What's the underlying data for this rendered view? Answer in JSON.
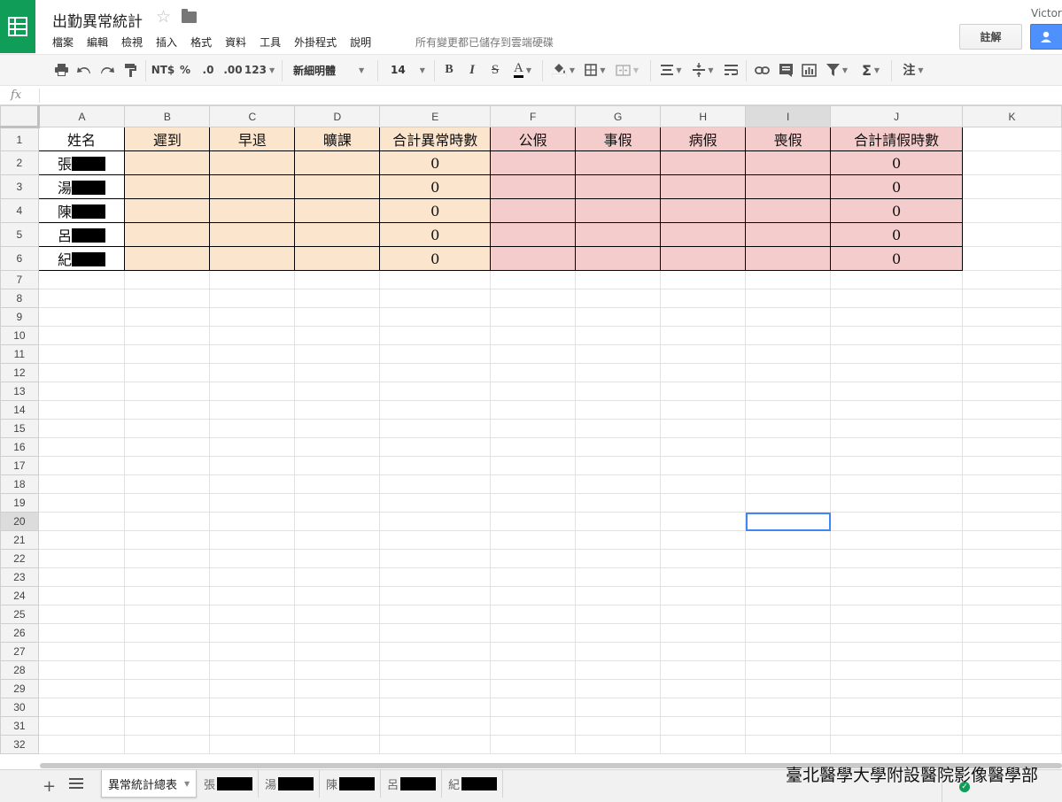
{
  "app": {
    "title": "出勤異常統計",
    "save_status": "所有變更都已儲存到雲端硬碟",
    "user_name": "Victor",
    "comments_label": "註解"
  },
  "menu": [
    "檔案",
    "編輯",
    "檢視",
    "插入",
    "格式",
    "資料",
    "工具",
    "外掛程式",
    "說明"
  ],
  "toolbar": {
    "currency": "NT$",
    "percent": "%",
    "decrease_decimals": ".0",
    "increase_decimals": ".00",
    "more_formats": "123",
    "font": "新細明體",
    "font_size": "14",
    "bold": "B",
    "italic": "I",
    "strike": "S",
    "text_color": "A",
    "sigma": "Σ",
    "notes": "注"
  },
  "formula_bar": {
    "fx": "fx",
    "value": ""
  },
  "columns": [
    "A",
    "B",
    "C",
    "D",
    "E",
    "F",
    "G",
    "H",
    "I",
    "J",
    "K"
  ],
  "active_column": "I",
  "active_row": "20",
  "rows": [
    "1",
    "2",
    "3",
    "4",
    "5",
    "6",
    "7",
    "8",
    "9",
    "10",
    "11",
    "12",
    "13",
    "14",
    "15",
    "16",
    "17",
    "18",
    "19",
    "20",
    "21",
    "22",
    "23",
    "24",
    "25",
    "26",
    "27",
    "28",
    "29",
    "30",
    "31",
    "32"
  ],
  "table": {
    "headers": [
      "姓名",
      "遲到",
      "早退",
      "曠課",
      "合計異常時數",
      "公假",
      "事假",
      "病假",
      "喪假",
      "合計請假時數"
    ],
    "rows": [
      [
        "張",
        "",
        "",
        "",
        "0",
        "",
        "",
        "",
        "",
        "0"
      ],
      [
        "湯",
        "",
        "",
        "",
        "0",
        "",
        "",
        "",
        "",
        "0"
      ],
      [
        "陳",
        "",
        "",
        "",
        "0",
        "",
        "",
        "",
        "",
        "0"
      ],
      [
        "呂",
        "",
        "",
        "",
        "0",
        "",
        "",
        "",
        "",
        "0"
      ],
      [
        "紀",
        "",
        "",
        "",
        "0",
        "",
        "",
        "",
        "",
        "0"
      ]
    ]
  },
  "colors": {
    "abnormal_section": "#fce5cd",
    "leave_section": "#f4cccc",
    "brand_green": "#0f9d58",
    "share_blue": "#4d90fe",
    "selection": "#4285f4"
  },
  "sheets": [
    "異常統計總表",
    "張",
    "湯",
    "陳",
    "呂",
    "紀"
  ],
  "watermark": "臺北醫學大學附設醫院影像醫學部"
}
